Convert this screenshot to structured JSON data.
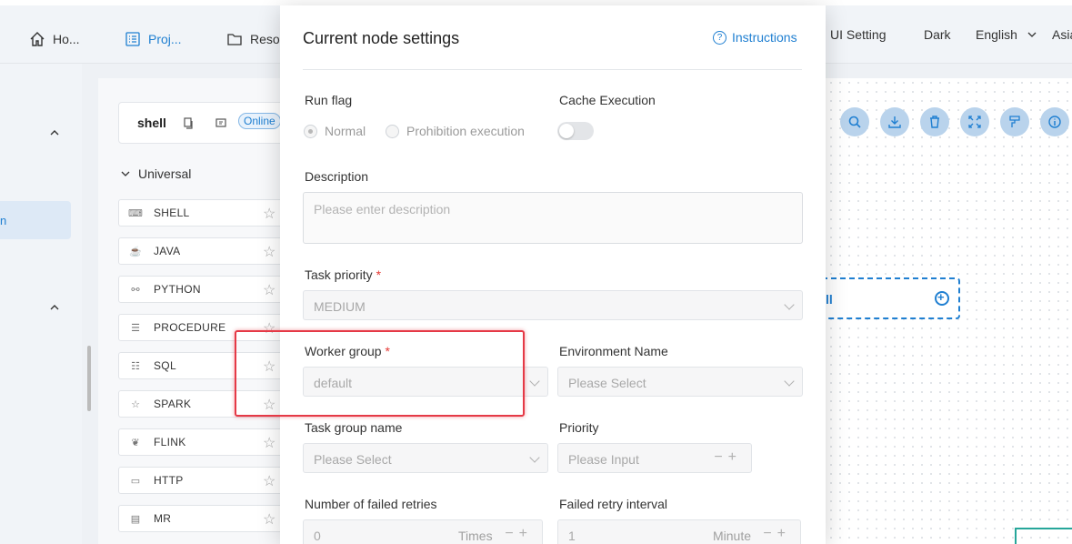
{
  "topnav": {
    "items": [
      {
        "label": "Ho...",
        "icon": "home-icon",
        "active": false
      },
      {
        "label": "Proj...",
        "icon": "project-icon",
        "active": true
      },
      {
        "label": "Reso",
        "icon": "folder-icon",
        "active": false
      }
    ],
    "right": {
      "ui_setting": "UI Setting",
      "theme": "Dark",
      "language": "English",
      "timezone": "Asia"
    }
  },
  "workflow": {
    "name": "shell",
    "status": "Online",
    "category": "Universal",
    "tasks": [
      {
        "label": "SHELL",
        "icon": "terminal-icon"
      },
      {
        "label": "JAVA",
        "icon": "java-icon"
      },
      {
        "label": "PYTHON",
        "icon": "python-icon"
      },
      {
        "label": "PROCEDURE",
        "icon": "procedure-icon"
      },
      {
        "label": "SQL",
        "icon": "sql-icon"
      },
      {
        "label": "SPARK",
        "icon": "spark-icon"
      },
      {
        "label": "FLINK",
        "icon": "flink-icon"
      },
      {
        "label": "HTTP",
        "icon": "http-icon"
      },
      {
        "label": "MR",
        "icon": "mr-icon"
      }
    ],
    "sidebar_active": "n",
    "canvas_node_label": "ll",
    "toolbar": [
      "search-icon",
      "download-icon",
      "delete-icon",
      "fullscreen-icon",
      "format-icon",
      "info-icon"
    ]
  },
  "modal": {
    "title": "Current node settings",
    "instructions": "Instructions",
    "run_flag": {
      "label": "Run flag",
      "options": [
        "Normal",
        "Prohibition execution"
      ],
      "selected": "Normal"
    },
    "cache_execution": {
      "label": "Cache Execution",
      "enabled": false
    },
    "description": {
      "label": "Description",
      "placeholder": "Please enter description"
    },
    "task_priority": {
      "label": "Task priority",
      "required": "*",
      "value": "MEDIUM"
    },
    "worker_group": {
      "label": "Worker group",
      "required": "*",
      "value": "default"
    },
    "environment": {
      "label": "Environment Name",
      "placeholder": "Please Select"
    },
    "task_group": {
      "label": "Task group name",
      "placeholder": "Please Select"
    },
    "priority": {
      "label": "Priority",
      "placeholder": "Please Input"
    },
    "failed_retries": {
      "label": "Number of failed retries",
      "value": "0",
      "unit": "Times"
    },
    "retry_interval": {
      "label": "Failed retry interval",
      "value": "1",
      "unit": "Minute"
    }
  }
}
